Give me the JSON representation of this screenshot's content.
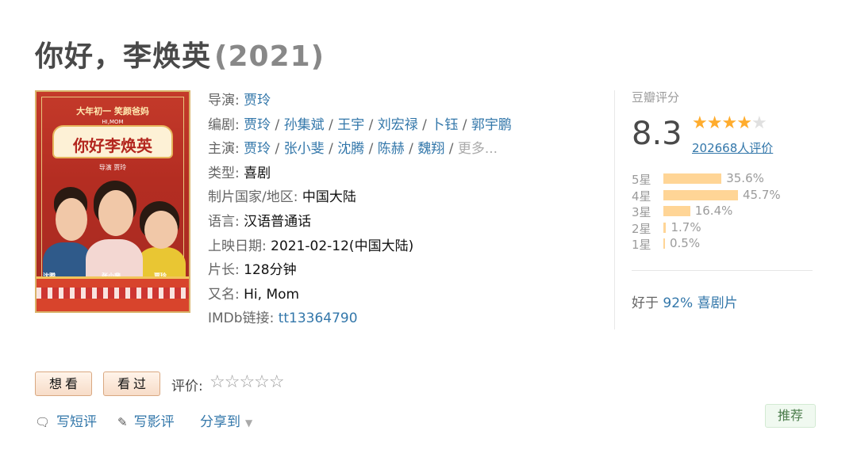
{
  "title": "你好，李焕英",
  "year": "(2021)",
  "poster": {
    "top_text": "大年初一 笑颜爸妈",
    "banner_sub": "HI,MOM",
    "banner_title": "你好李焕英",
    "director_tag": "导演 贾玲",
    "actor_left": "沈腾",
    "actor_center": "张小斐",
    "actor_right": "贾玲"
  },
  "info": {
    "director_label": "导演",
    "directors": [
      "贾玲"
    ],
    "writer_label": "编剧",
    "writers": [
      "贾玲",
      "孙集斌",
      "王宇",
      "刘宏禄",
      "卜钰",
      "郭宇鹏"
    ],
    "cast_label": "主演",
    "cast": [
      "贾玲",
      "张小斐",
      "沈腾",
      "陈赫",
      "魏翔"
    ],
    "cast_more": "更多...",
    "genre_label": "类型",
    "genre": "喜剧",
    "country_label": "制片国家/地区",
    "country": "中国大陆",
    "language_label": "语言",
    "language": "汉语普通话",
    "release_label": "上映日期",
    "release": "2021-02-12(中国大陆)",
    "runtime_label": "片长",
    "runtime": "128分钟",
    "aka_label": "又名",
    "aka": "Hi, Mom",
    "imdb_label": "IMDb链接",
    "imdb": "tt13364790"
  },
  "rating": {
    "label": "豆瓣评分",
    "score": "8.3",
    "stars_filled": 4,
    "stars_total": 5,
    "count_text": "202668人评价",
    "distribution": [
      {
        "label": "5星",
        "percent": 35.6,
        "text": "35.6%"
      },
      {
        "label": "4星",
        "percent": 45.7,
        "text": "45.7%"
      },
      {
        "label": "3星",
        "percent": 16.4,
        "text": "16.4%"
      },
      {
        "label": "2星",
        "percent": 1.7,
        "text": "1.7%"
      },
      {
        "label": "1星",
        "percent": 0.5,
        "text": "0.5%"
      }
    ],
    "better_prefix": "好于",
    "better_pct": "92%",
    "better_genre": "喜剧片"
  },
  "actions": {
    "want": "想看",
    "seen": "看过",
    "rate_label": "评价:",
    "rate_stars": "☆☆☆☆☆",
    "short_review": "写短评",
    "review": "写影评",
    "share": "分享到",
    "recommend": "推荐"
  }
}
